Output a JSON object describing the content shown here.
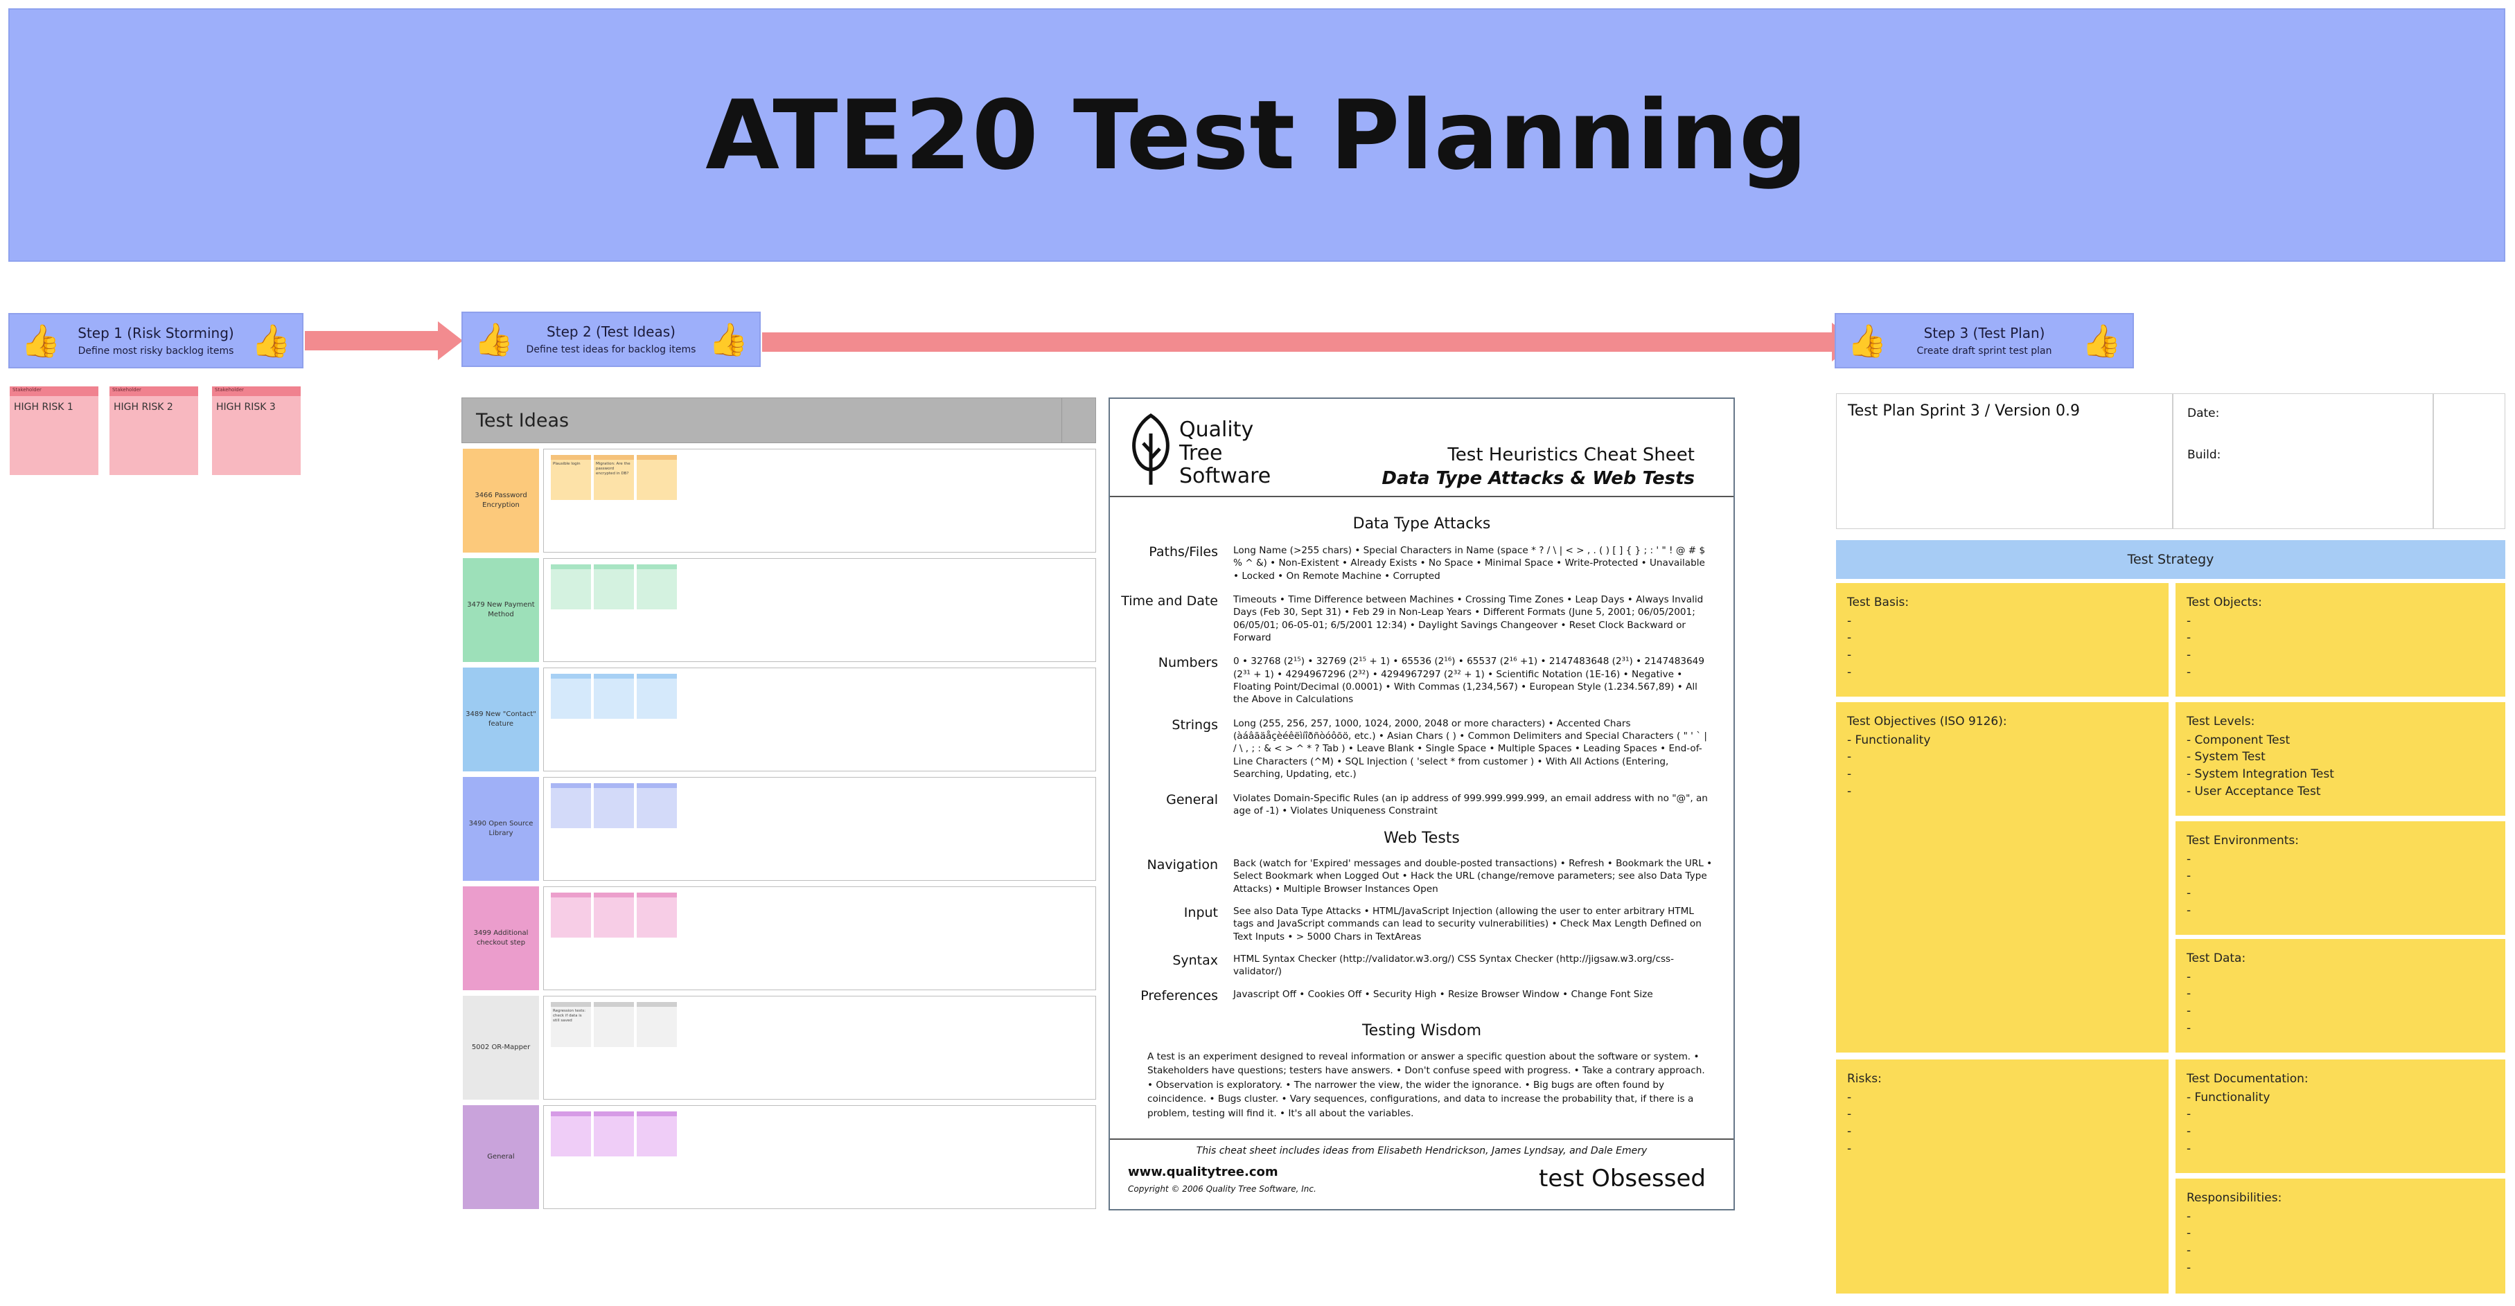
{
  "banner": {
    "title": "ATE20 Test Planning"
  },
  "steps": [
    {
      "title": "Step 1 (Risk Storming)",
      "subtitle": "Define most risky backlog items",
      "icon": "thumbs-up-icon"
    },
    {
      "title": "Step 2 (Test Ideas)",
      "subtitle": "Define test ideas for backlog items",
      "icon": "thumbs-up-icon"
    },
    {
      "title": "Step 3 (Test Plan)",
      "subtitle": "Create draft sprint test plan",
      "icon": "thumbs-up-icon"
    }
  ],
  "risks": [
    {
      "label": "HIGH RISK 1",
      "tag": "Stakeholder"
    },
    {
      "label": "HIGH RISK 2",
      "tag": "Stakeholder"
    },
    {
      "label": "HIGH RISK 3",
      "tag": "Stakeholder"
    }
  ],
  "test_ideas": {
    "header": "Test Ideas",
    "rows": [
      {
        "category": "3466 Password Encryption",
        "color": "#fcc97b",
        "note_color": "#fde2a8",
        "note_border": "#f5c27a",
        "notes": [
          "Plausible login",
          "Migration: Are the password encrypted in DB?",
          ""
        ]
      },
      {
        "category": "3479 New Payment Method",
        "color": "#9de0b9",
        "note_color": "#d4f2e0",
        "note_border": "#a8e4c3",
        "notes": [
          "",
          "",
          ""
        ]
      },
      {
        "category": "3489 New \"Contact\" feature",
        "color": "#9ccbf2",
        "note_color": "#d5e9fb",
        "note_border": "#a7d0f4",
        "notes": [
          "",
          "",
          ""
        ]
      },
      {
        "category": "3490 Open Source Library",
        "color": "#9fb0f7",
        "note_color": "#d3daf9",
        "note_border": "#a9b6f4",
        "notes": [
          "",
          "",
          ""
        ]
      },
      {
        "category": "3499 Additional checkout step",
        "color": "#eb9dcc",
        "note_color": "#f7cde6",
        "note_border": "#ec9fcc",
        "notes": [
          "",
          "",
          ""
        ]
      },
      {
        "category": "5002 OR-Mapper",
        "color": "#e8e8e8",
        "note_color": "#f1f1f1",
        "note_border": "#cfcfcf",
        "notes": [
          "Regression tests: check if data is still saved",
          "",
          ""
        ]
      },
      {
        "category": "General",
        "color": "#c9a3db",
        "note_color": "#efcdf7",
        "note_border": "#d69be6",
        "notes": [
          "",
          "",
          ""
        ]
      }
    ]
  },
  "cheat_sheet": {
    "brand": [
      "Quality",
      "Tree",
      "Software"
    ],
    "title": "Test Heuristics Cheat Sheet",
    "subtitle": "Data Type Attacks & Web Tests",
    "section_data": "Data Type Attacks",
    "data_rows": [
      {
        "label": "Paths/Files",
        "text": "Long Name (>255 chars) • Special Characters in Name (space * ? / \\ | < > , . ( ) [ ] { } ; : ' \" ! @ # $ % ^ &) • Non-Existent • Already Exists • No Space • Minimal Space • Write-Protected • Unavailable • Locked • On Remote Machine • Corrupted"
      },
      {
        "label": "Time and Date",
        "text": "Timeouts • Time Difference between Machines • Crossing Time Zones • Leap Days • Always Invalid Days (Feb 30, Sept 31) • Feb 29 in Non-Leap Years • Different Formats (June 5, 2001; 06/05/2001; 06/05/01; 06-05-01; 6/5/2001 12:34) • Daylight Savings Changeover • Reset Clock Backward or Forward"
      },
      {
        "label": "Numbers",
        "text": "0 • 32768 (2¹⁵) • 32769 (2¹⁵ + 1) • 65536 (2¹⁶) • 65537 (2¹⁶ +1) • 2147483648 (2³¹) • 2147483649 (2³¹ + 1) • 4294967296 (2³²) • 4294967297 (2³² + 1) • Scientific Notation (1E-16) • Negative • Floating Point/Decimal (0.0001) • With Commas (1,234,567) • European Style (1.234.567,89) • All the Above in Calculations"
      },
      {
        "label": "Strings",
        "text": "Long (255, 256, 257, 1000, 1024, 2000, 2048 or more characters) • Accented Chars (àáâãäåçèéêëìíîðñòóôõö, etc.) • Asian Chars ( ) • Common Delimiters and Special Characters ( \" ' ` | / \\ , ; : & < > ^ * ? Tab ) • Leave Blank • Single Space • Multiple Spaces • Leading Spaces • End-of-Line Characters (^M) • SQL Injection ( 'select * from customer ) • With All Actions (Entering, Searching, Updating, etc.)"
      },
      {
        "label": "General",
        "text": "Violates Domain-Specific Rules (an ip address of 999.999.999.999, an email address with no \"@\", an age of -1) • Violates Uniqueness Constraint"
      }
    ],
    "section_web": "Web Tests",
    "web_rows": [
      {
        "label": "Navigation",
        "text": "Back (watch for 'Expired' messages and double-posted transactions) • Refresh • Bookmark the URL • Select Bookmark when Logged Out • Hack the URL (change/remove parameters; see also Data Type Attacks) • Multiple Browser Instances Open"
      },
      {
        "label": "Input",
        "text": "See also Data Type Attacks • HTML/JavaScript Injection (allowing the user to enter arbitrary HTML tags and JavaScript commands can lead to security vulnerabilities) • Check Max Length Defined on Text Inputs • > 5000 Chars in TextAreas"
      },
      {
        "label": "Syntax",
        "text": "HTML Syntax Checker (http://validator.w3.org/) CSS Syntax Checker (http://jigsaw.w3.org/css-validator/)"
      },
      {
        "label": "Preferences",
        "text": "Javascript Off • Cookies Off • Security High • Resize Browser Window • Change Font Size"
      }
    ],
    "section_wisdom": "Testing Wisdom",
    "wisdom": "A test is an experiment designed to reveal information or answer a specific question about the software or system. • Stakeholders have questions; testers have answers. • Don't confuse speed with progress. • Take a contrary approach. • Observation is exploratory. • The narrower the view, the wider the ignorance. • Big bugs are often found by coincidence. • Bugs cluster. • Vary sequences, configurations, and data to increase the probability that, if there is a problem, testing will find it. • It's all about the variables.",
    "credits": "This cheat sheet includes ideas from Elisabeth Hendrickson, James Lyndsay, and Dale Emery",
    "url": "www.qualitytree.com",
    "copyright": "Copyright © 2006 Quality Tree Software, Inc.",
    "logo_text": "test Obsessed"
  },
  "test_plan": {
    "title": "Test Plan Sprint 3 / Version 0.9",
    "date_label": "Date:",
    "build_label": "Build:",
    "strategy_header": "Test Strategy",
    "boxes": {
      "basis": {
        "title": "Test Basis:",
        "lines": [
          "-",
          "-",
          "-",
          "-"
        ]
      },
      "objects": {
        "title": "Test Objects:",
        "lines": [
          "-",
          "-",
          "-",
          "-"
        ]
      },
      "objectives": {
        "title": "Test Objectives (ISO 9126):",
        "lines": [
          "- Functionality",
          "-",
          "-",
          "-"
        ]
      },
      "levels": {
        "title": "Test Levels:",
        "lines": [
          "- Component Test",
          "- System Test",
          "- System Integration Test",
          "- User Acceptance Test"
        ]
      },
      "environments": {
        "title": "Test Environments:",
        "lines": [
          "-",
          "-",
          "-",
          "-"
        ]
      },
      "data": {
        "title": "Test Data:",
        "lines": [
          "-",
          "-",
          "-",
          "-"
        ]
      },
      "risks": {
        "title": "Risks:",
        "lines": [
          "-",
          "-",
          "-",
          "-"
        ]
      },
      "documentation": {
        "title": "Test Documentation:",
        "lines": [
          "- Functionality",
          "-",
          "-",
          "-"
        ]
      },
      "responsibilities": {
        "title": "Responsibilities:",
        "lines": [
          "-",
          "-",
          "-",
          "-"
        ]
      }
    }
  }
}
